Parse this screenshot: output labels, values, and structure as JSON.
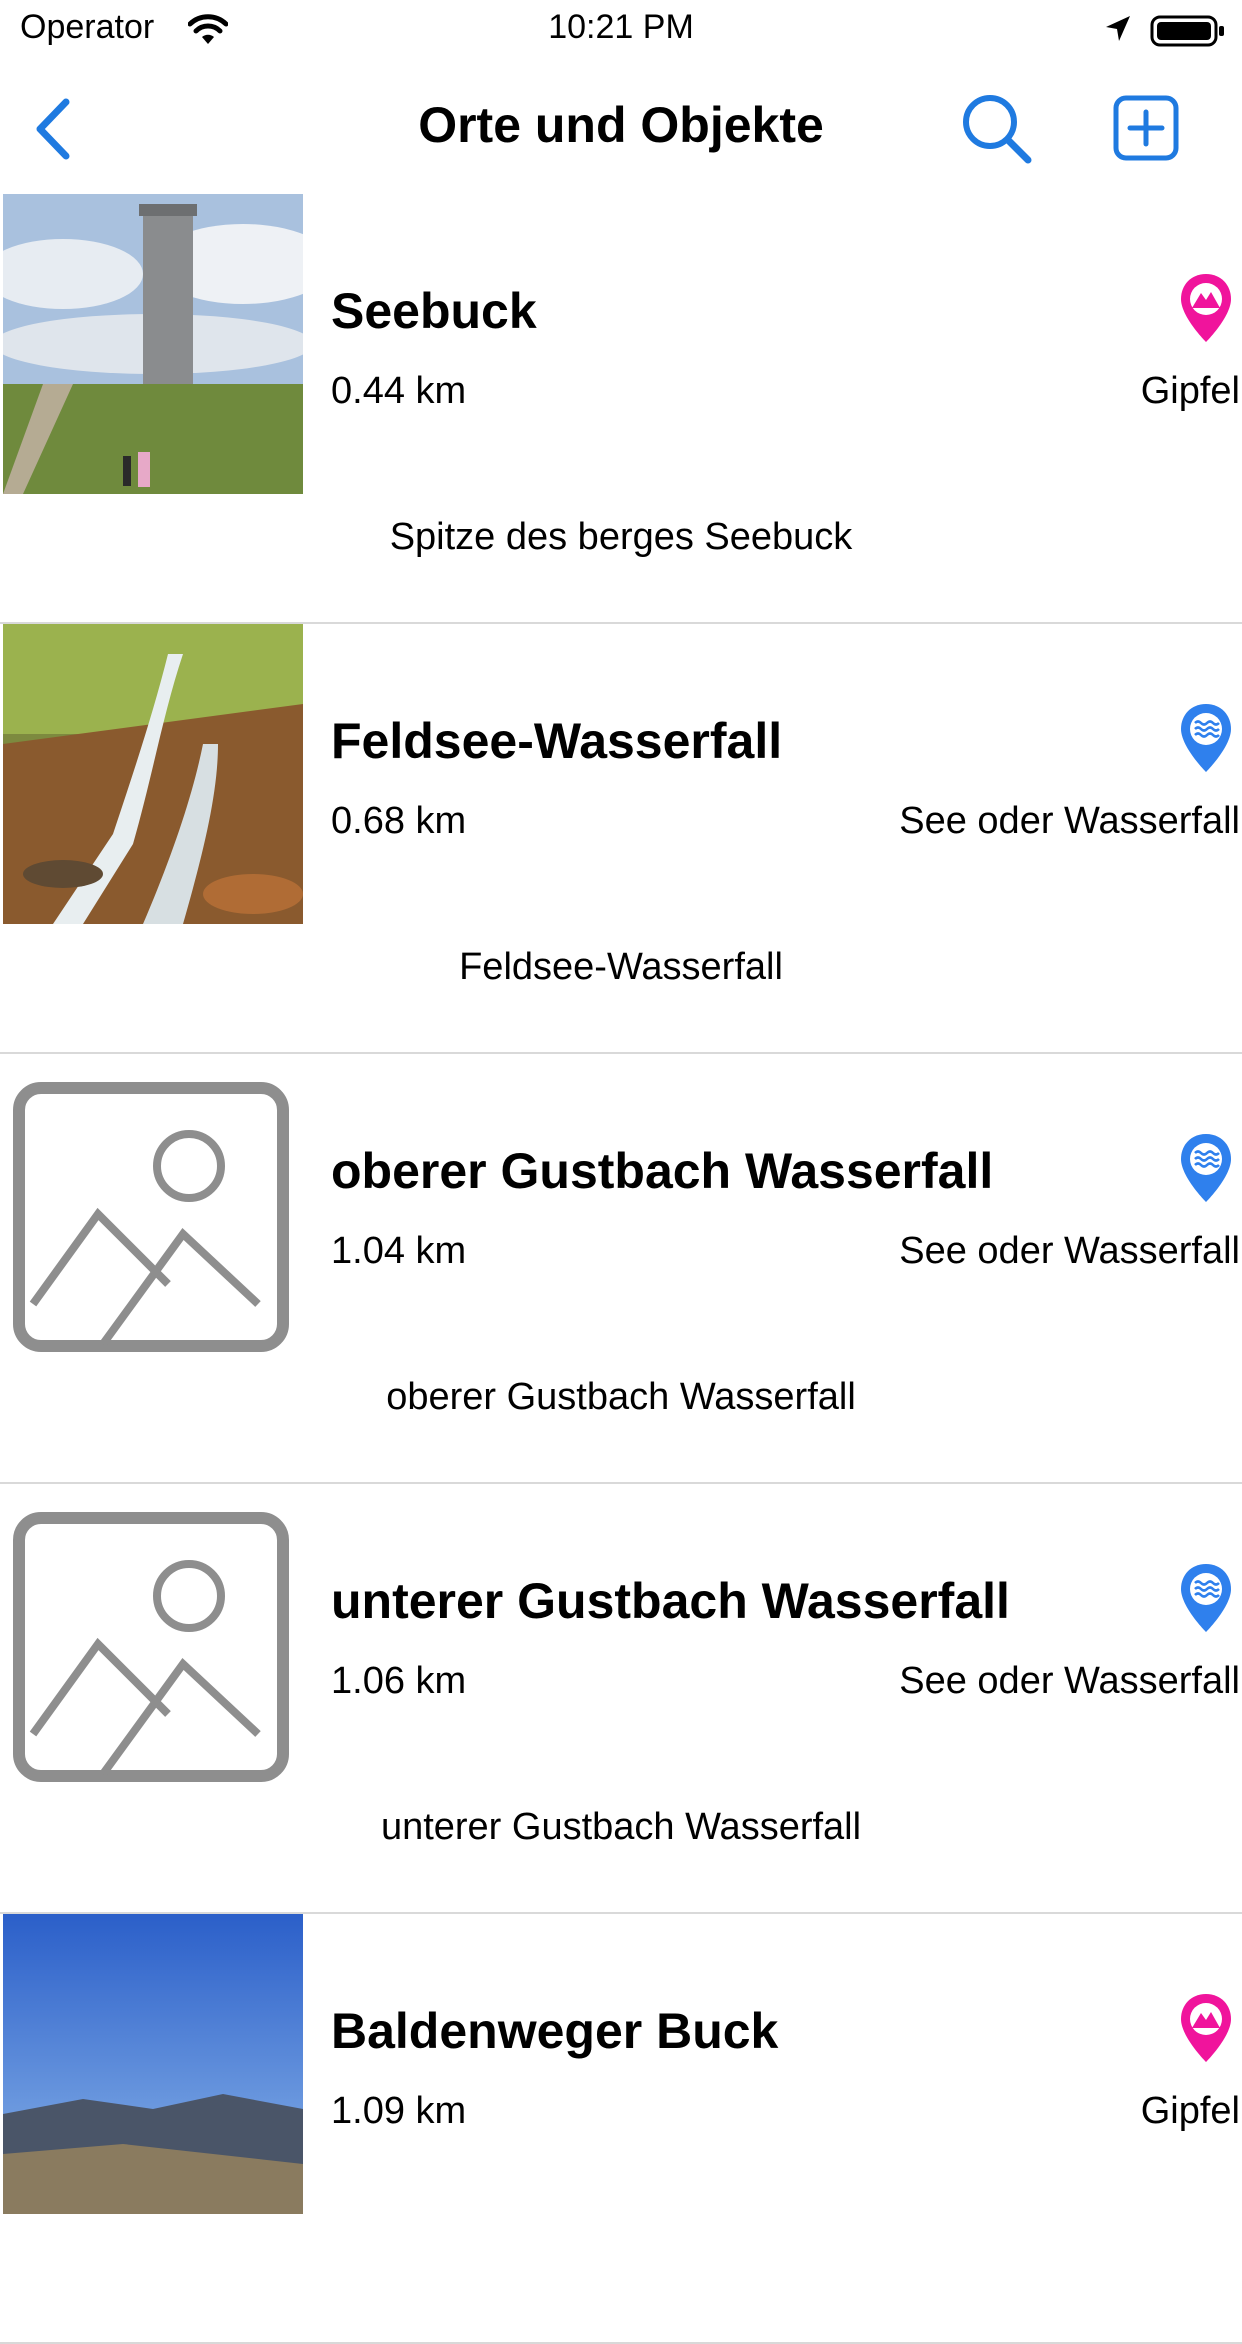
{
  "status": {
    "carrier": "Operator",
    "time": "10:21 PM",
    "wifi_icon": "wifi-icon",
    "location_icon": "location-arrow-icon",
    "battery_icon": "battery-icon"
  },
  "nav": {
    "title": "Orte und Objekte",
    "back_icon": "chevron-left-icon",
    "search_icon": "search-icon",
    "add_icon": "plus-square-icon",
    "accent": "#1f7ae0"
  },
  "colors": {
    "gipfel_pin": "#f0149c",
    "wasser_pin": "#2f80ed",
    "placeholder": "#8e8e8e",
    "divider": "#d9d9d9"
  },
  "items": [
    {
      "name": "Seebuck",
      "distance": "0.44 km",
      "category": "Gipfel",
      "description": "Spitze des berges Seebuck",
      "image": "photo-tower",
      "pin": "mountain-pin-icon"
    },
    {
      "name": "Feldsee-Wasserfall",
      "distance": "0.68 km",
      "category": "See oder Wasserfall",
      "description": "Feldsee-Wasserfall",
      "image": "photo-waterfall",
      "pin": "water-pin-icon"
    },
    {
      "name": "oberer Gustbach Wasserfall",
      "distance": "1.04 km",
      "category": "See oder Wasserfall",
      "description": "oberer Gustbach Wasserfall",
      "image": "placeholder-image",
      "pin": "water-pin-icon"
    },
    {
      "name": "unterer Gustbach Wasserfall",
      "distance": "1.06 km",
      "category": "See oder Wasserfall",
      "description": "unterer Gustbach Wasserfall",
      "image": "placeholder-image",
      "pin": "water-pin-icon"
    },
    {
      "name": "Baldenweger Buck",
      "distance": "1.09 km",
      "category": "Gipfel",
      "description": "",
      "image": "photo-sky",
      "pin": "mountain-pin-icon"
    }
  ]
}
